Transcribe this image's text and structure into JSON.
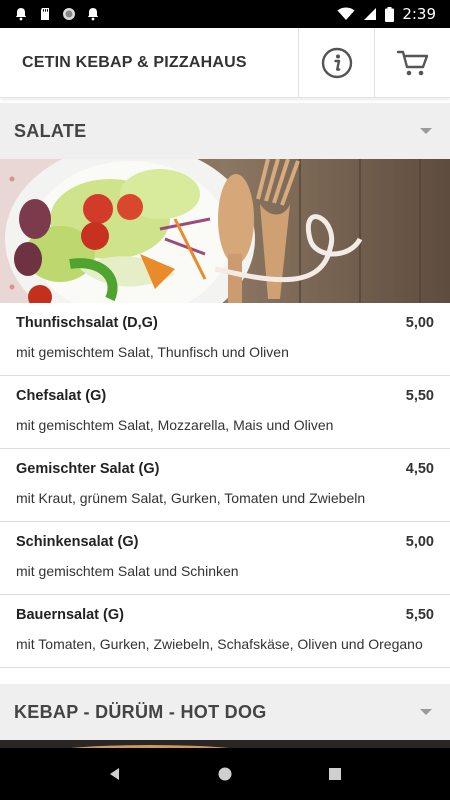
{
  "status_bar": {
    "time": "2:39",
    "icons": [
      "notification-bell-icon",
      "sd-card-icon",
      "circle-icon",
      "notification-bell-icon",
      "wifi-icon",
      "signal-icon",
      "battery-icon"
    ]
  },
  "app_bar": {
    "title": "CETIN KEBAP & PIZZAHAUS",
    "info_icon": "info-icon",
    "cart_icon": "cart-icon"
  },
  "sections": [
    {
      "title": "SALATE",
      "items": [
        {
          "name": "Thunfischsalat (D,G)",
          "price": "5,00",
          "description": "mit gemischtem Salat, Thunfisch und Oliven"
        },
        {
          "name": "Chefsalat (G)",
          "price": "5,50",
          "description": "mit gemischtem Salat, Mozzarella, Mais und Oliven"
        },
        {
          "name": "Gemischter Salat (G)",
          "price": "4,50",
          "description": "mit Kraut, grünem Salat, Gurken, Tomaten und Zwiebeln"
        },
        {
          "name": "Schinkensalat (G)",
          "price": "5,00",
          "description": "mit gemischtem Salat und Schinken"
        },
        {
          "name": "Bauernsalat (G)",
          "price": "5,50",
          "description": "mit Tomaten, Gurken, Zwiebeln, Schafskäse, Oliven und Oregano"
        }
      ]
    },
    {
      "title": "KEBAP - DÜRÜM - HOT DOG"
    }
  ],
  "nav_bar": {
    "icons": [
      "back-icon",
      "home-icon",
      "recents-icon"
    ]
  },
  "colors": {
    "section_bg": "#efefef",
    "divider": "#dcdcdc",
    "status_bg": "#000000"
  }
}
